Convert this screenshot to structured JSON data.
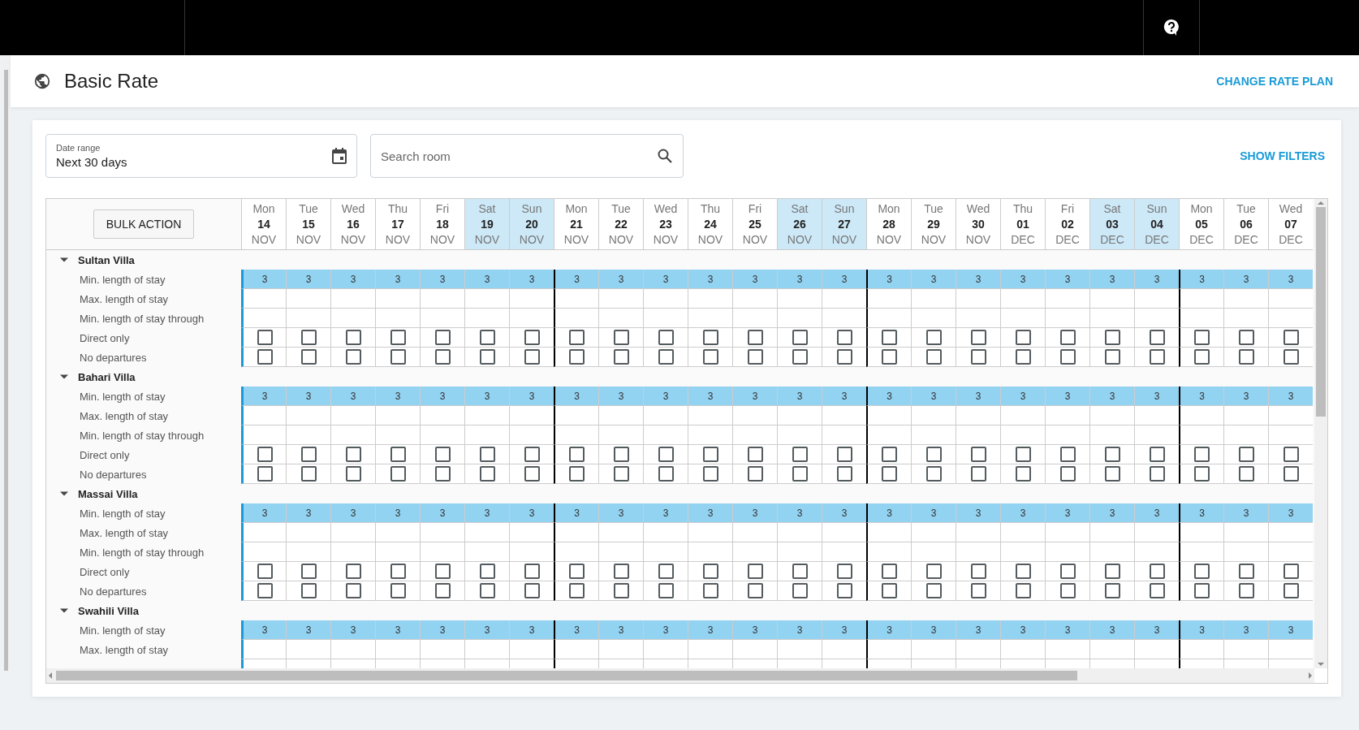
{
  "header": {
    "title": "Basic Rate",
    "action": "CHANGE RATE PLAN"
  },
  "filters": {
    "date_range": {
      "label": "Date range",
      "value": "Next 30 days"
    },
    "search": {
      "placeholder": "Search room"
    },
    "show_filters": "SHOW FILTERS"
  },
  "grid": {
    "bulk_action": "BULK ACTION",
    "days": [
      {
        "weekday": "Mon",
        "day": "14",
        "month": "NOV",
        "weekend": false
      },
      {
        "weekday": "Tue",
        "day": "15",
        "month": "NOV",
        "weekend": false
      },
      {
        "weekday": "Wed",
        "day": "16",
        "month": "NOV",
        "weekend": false
      },
      {
        "weekday": "Thu",
        "day": "17",
        "month": "NOV",
        "weekend": false
      },
      {
        "weekday": "Fri",
        "day": "18",
        "month": "NOV",
        "weekend": false
      },
      {
        "weekday": "Sat",
        "day": "19",
        "month": "NOV",
        "weekend": true
      },
      {
        "weekday": "Sun",
        "day": "20",
        "month": "NOV",
        "weekend": true
      },
      {
        "weekday": "Mon",
        "day": "21",
        "month": "NOV",
        "weekend": false
      },
      {
        "weekday": "Tue",
        "day": "22",
        "month": "NOV",
        "weekend": false
      },
      {
        "weekday": "Wed",
        "day": "23",
        "month": "NOV",
        "weekend": false
      },
      {
        "weekday": "Thu",
        "day": "24",
        "month": "NOV",
        "weekend": false
      },
      {
        "weekday": "Fri",
        "day": "25",
        "month": "NOV",
        "weekend": false
      },
      {
        "weekday": "Sat",
        "day": "26",
        "month": "NOV",
        "weekend": true
      },
      {
        "weekday": "Sun",
        "day": "27",
        "month": "NOV",
        "weekend": true
      },
      {
        "weekday": "Mon",
        "day": "28",
        "month": "NOV",
        "weekend": false
      },
      {
        "weekday": "Tue",
        "day": "29",
        "month": "NOV",
        "weekend": false
      },
      {
        "weekday": "Wed",
        "day": "30",
        "month": "NOV",
        "weekend": false
      },
      {
        "weekday": "Thu",
        "day": "01",
        "month": "DEC",
        "weekend": false
      },
      {
        "weekday": "Fri",
        "day": "02",
        "month": "DEC",
        "weekend": false
      },
      {
        "weekday": "Sat",
        "day": "03",
        "month": "DEC",
        "weekend": true
      },
      {
        "weekday": "Sun",
        "day": "04",
        "month": "DEC",
        "weekend": true
      },
      {
        "weekday": "Mon",
        "day": "05",
        "month": "DEC",
        "weekend": false
      },
      {
        "weekday": "Tue",
        "day": "06",
        "month": "DEC",
        "weekend": false
      },
      {
        "weekday": "Wed",
        "day": "07",
        "month": "DEC",
        "weekend": false
      }
    ],
    "rooms": [
      {
        "name": "Sultan Villa",
        "expanded": true,
        "rows": [
          {
            "label": "Min. length of stay",
            "kind": "value",
            "values": [
              "3",
              "3",
              "3",
              "3",
              "3",
              "3",
              "3",
              "3",
              "3",
              "3",
              "3",
              "3",
              "3",
              "3",
              "3",
              "3",
              "3",
              "3",
              "3",
              "3",
              "3",
              "3",
              "3",
              "3"
            ]
          },
          {
            "label": "Max. length of stay",
            "kind": "empty"
          },
          {
            "label": "Min. length of stay through",
            "kind": "empty"
          },
          {
            "label": "Direct only",
            "kind": "checkbox",
            "cells": [
              {
                "checked": false
              },
              {
                "checked": false
              },
              {
                "checked": false
              },
              {
                "checked": false
              },
              {
                "checked": false
              },
              {
                "checked": false
              },
              {
                "checked": false
              },
              {
                "checked": false
              },
              {
                "checked": false
              },
              {
                "checked": false
              },
              {
                "checked": false
              },
              {
                "checked": false
              },
              {
                "checked": false
              },
              {
                "checked": false
              },
              {
                "checked": false
              },
              {
                "checked": false
              },
              {
                "checked": false
              },
              {
                "checked": false
              },
              {
                "checked": false
              },
              {
                "checked": false
              },
              {
                "checked": false
              },
              {
                "checked": false
              },
              {
                "checked": false
              },
              {
                "checked": false
              }
            ]
          },
          {
            "label": "No departures",
            "kind": "checkbox",
            "cells": [
              {
                "checked": false
              },
              {
                "checked": false
              },
              {
                "checked": false
              },
              {
                "checked": false
              },
              {
                "checked": false
              },
              {
                "checked": false
              },
              {
                "checked": false
              },
              {
                "checked": false
              },
              {
                "checked": false
              },
              {
                "checked": false
              },
              {
                "checked": false
              },
              {
                "checked": false
              },
              {
                "checked": false
              },
              {
                "checked": false
              },
              {
                "checked": false
              },
              {
                "checked": false
              },
              {
                "checked": false
              },
              {
                "checked": false
              },
              {
                "checked": false
              },
              {
                "checked": false
              },
              {
                "checked": false
              },
              {
                "checked": false
              },
              {
                "checked": false
              },
              {
                "checked": false
              }
            ]
          }
        ]
      },
      {
        "name": "Bahari Villa",
        "expanded": true,
        "rows": [
          {
            "label": "Min. length of stay",
            "kind": "value",
            "values": [
              "3",
              "3",
              "3",
              "3",
              "3",
              "3",
              "3",
              "3",
              "3",
              "3",
              "3",
              "3",
              "3",
              "3",
              "3",
              "3",
              "3",
              "3",
              "3",
              "3",
              "3",
              "3",
              "3",
              "3"
            ]
          },
          {
            "label": "Max. length of stay",
            "kind": "empty"
          },
          {
            "label": "Min. length of stay through",
            "kind": "empty"
          },
          {
            "label": "Direct only",
            "kind": "checkbox",
            "cells": [
              {
                "checked": false
              },
              {
                "checked": false
              },
              {
                "checked": false
              },
              {
                "checked": false
              },
              {
                "checked": false
              },
              {
                "checked": false
              },
              {
                "checked": false
              },
              {
                "checked": false
              },
              {
                "checked": false
              },
              {
                "checked": false
              },
              {
                "checked": false
              },
              {
                "checked": false
              },
              {
                "checked": false
              },
              {
                "checked": false
              },
              {
                "checked": false
              },
              {
                "checked": false
              },
              {
                "checked": false
              },
              {
                "checked": false
              },
              {
                "checked": false
              },
              {
                "checked": false
              },
              {
                "checked": false
              },
              {
                "checked": false
              },
              {
                "checked": false
              },
              {
                "checked": false
              }
            ]
          },
          {
            "label": "No departures",
            "kind": "checkbox",
            "cells": [
              {
                "checked": false
              },
              {
                "checked": false
              },
              {
                "checked": false
              },
              {
                "checked": false
              },
              {
                "checked": false
              },
              {
                "checked": false
              },
              {
                "checked": false
              },
              {
                "checked": false
              },
              {
                "checked": false
              },
              {
                "checked": false
              },
              {
                "checked": false
              },
              {
                "checked": false
              },
              {
                "checked": false
              },
              {
                "checked": false
              },
              {
                "checked": false
              },
              {
                "checked": false
              },
              {
                "checked": false
              },
              {
                "checked": false
              },
              {
                "checked": false
              },
              {
                "checked": false
              },
              {
                "checked": false
              },
              {
                "checked": false
              },
              {
                "checked": false
              },
              {
                "checked": false
              }
            ]
          }
        ]
      },
      {
        "name": "Massai Villa",
        "expanded": true,
        "rows": [
          {
            "label": "Min. length of stay",
            "kind": "value",
            "values": [
              "3",
              "3",
              "3",
              "3",
              "3",
              "3",
              "3",
              "3",
              "3",
              "3",
              "3",
              "3",
              "3",
              "3",
              "3",
              "3",
              "3",
              "3",
              "3",
              "3",
              "3",
              "3",
              "3",
              "3"
            ]
          },
          {
            "label": "Max. length of stay",
            "kind": "empty"
          },
          {
            "label": "Min. length of stay through",
            "kind": "empty"
          },
          {
            "label": "Direct only",
            "kind": "checkbox",
            "cells": [
              {
                "checked": false
              },
              {
                "checked": false
              },
              {
                "checked": false
              },
              {
                "checked": false
              },
              {
                "checked": false
              },
              {
                "checked": false
              },
              {
                "checked": false
              },
              {
                "checked": false
              },
              {
                "checked": false
              },
              {
                "checked": false
              },
              {
                "checked": false
              },
              {
                "checked": false
              },
              {
                "checked": false
              },
              {
                "checked": false
              },
              {
                "checked": false
              },
              {
                "checked": false
              },
              {
                "checked": false
              },
              {
                "checked": false
              },
              {
                "checked": false
              },
              {
                "checked": false
              },
              {
                "checked": false
              },
              {
                "checked": false
              },
              {
                "checked": false
              },
              {
                "checked": false
              }
            ]
          },
          {
            "label": "No departures",
            "kind": "checkbox",
            "cells": [
              {
                "checked": false
              },
              {
                "checked": false
              },
              {
                "checked": false
              },
              {
                "checked": false
              },
              {
                "checked": false
              },
              {
                "checked": false
              },
              {
                "checked": false
              },
              {
                "checked": false
              },
              {
                "checked": false
              },
              {
                "checked": false
              },
              {
                "checked": false
              },
              {
                "checked": false
              },
              {
                "checked": false
              },
              {
                "checked": false
              },
              {
                "checked": false
              },
              {
                "checked": false
              },
              {
                "checked": false
              },
              {
                "checked": false
              },
              {
                "checked": false
              },
              {
                "checked": false
              },
              {
                "checked": false
              },
              {
                "checked": false
              },
              {
                "checked": false
              },
              {
                "checked": false
              }
            ]
          }
        ]
      },
      {
        "name": "Swahili Villa",
        "expanded": true,
        "rows": [
          {
            "label": "Min. length of stay",
            "kind": "value",
            "values": [
              "3",
              "3",
              "3",
              "3",
              "3",
              "3",
              "3",
              "3",
              "3",
              "3",
              "3",
              "3",
              "3",
              "3",
              "3",
              "3",
              "3",
              "3",
              "3",
              "3",
              "3",
              "3",
              "3",
              "3"
            ]
          },
          {
            "label": "Max. length of stay",
            "kind": "empty"
          }
        ]
      }
    ]
  }
}
